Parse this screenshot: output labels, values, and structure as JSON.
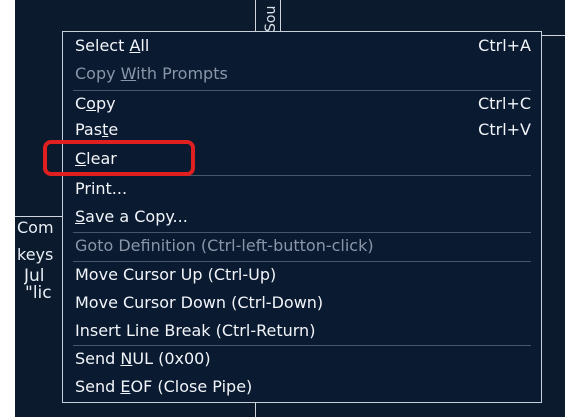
{
  "background": {
    "tab_vertical": "Sou",
    "left_text": {
      "com": "Com",
      "keys": "keys",
      "jul": "Jul",
      "lic": "\"lic"
    }
  },
  "menu": {
    "items": [
      {
        "pre": "Select ",
        "key": "A",
        "post": "ll",
        "shortcut": "Ctrl+A",
        "disabled": false
      },
      {
        "pre": "Copy ",
        "key": "W",
        "post": "ith Prompts",
        "shortcut": "",
        "disabled": true
      },
      {
        "pre": "C",
        "key": "o",
        "post": "py",
        "shortcut": "Ctrl+C",
        "disabled": false
      },
      {
        "pre": "Pas",
        "key": "t",
        "post": "e",
        "shortcut": "Ctrl+V",
        "disabled": false
      },
      {
        "pre": "",
        "key": "C",
        "post": "lear",
        "shortcut": "",
        "disabled": false
      },
      {
        "pre": "Print...",
        "key": "",
        "post": "",
        "shortcut": "",
        "disabled": false
      },
      {
        "pre": "",
        "key": "S",
        "post": "ave a Copy...",
        "shortcut": "",
        "disabled": false
      },
      {
        "pre": "Goto Definition (Ctrl-left-button-click)",
        "key": "",
        "post": "",
        "shortcut": "",
        "disabled": true
      },
      {
        "pre": "Move Cursor Up (Ctrl-Up)",
        "key": "",
        "post": "",
        "shortcut": "",
        "disabled": false
      },
      {
        "pre": "Move Cursor Down (Ctrl-Down)",
        "key": "",
        "post": "",
        "shortcut": "",
        "disabled": false
      },
      {
        "pre": "Insert Line Break (Ctrl-Return)",
        "key": "",
        "post": "",
        "shortcut": "",
        "disabled": false
      },
      {
        "pre": "Send ",
        "key": "N",
        "post": "UL (0x00)",
        "shortcut": "",
        "disabled": false
      },
      {
        "pre": "Send ",
        "key": "E",
        "post": "OF (Close Pipe)",
        "shortcut": "",
        "disabled": false
      }
    ]
  },
  "colors": {
    "menu_bg": "#0a1a30",
    "text": "#f2f5fa",
    "disabled_text": "#8a96a8",
    "highlight": "#e02020"
  }
}
